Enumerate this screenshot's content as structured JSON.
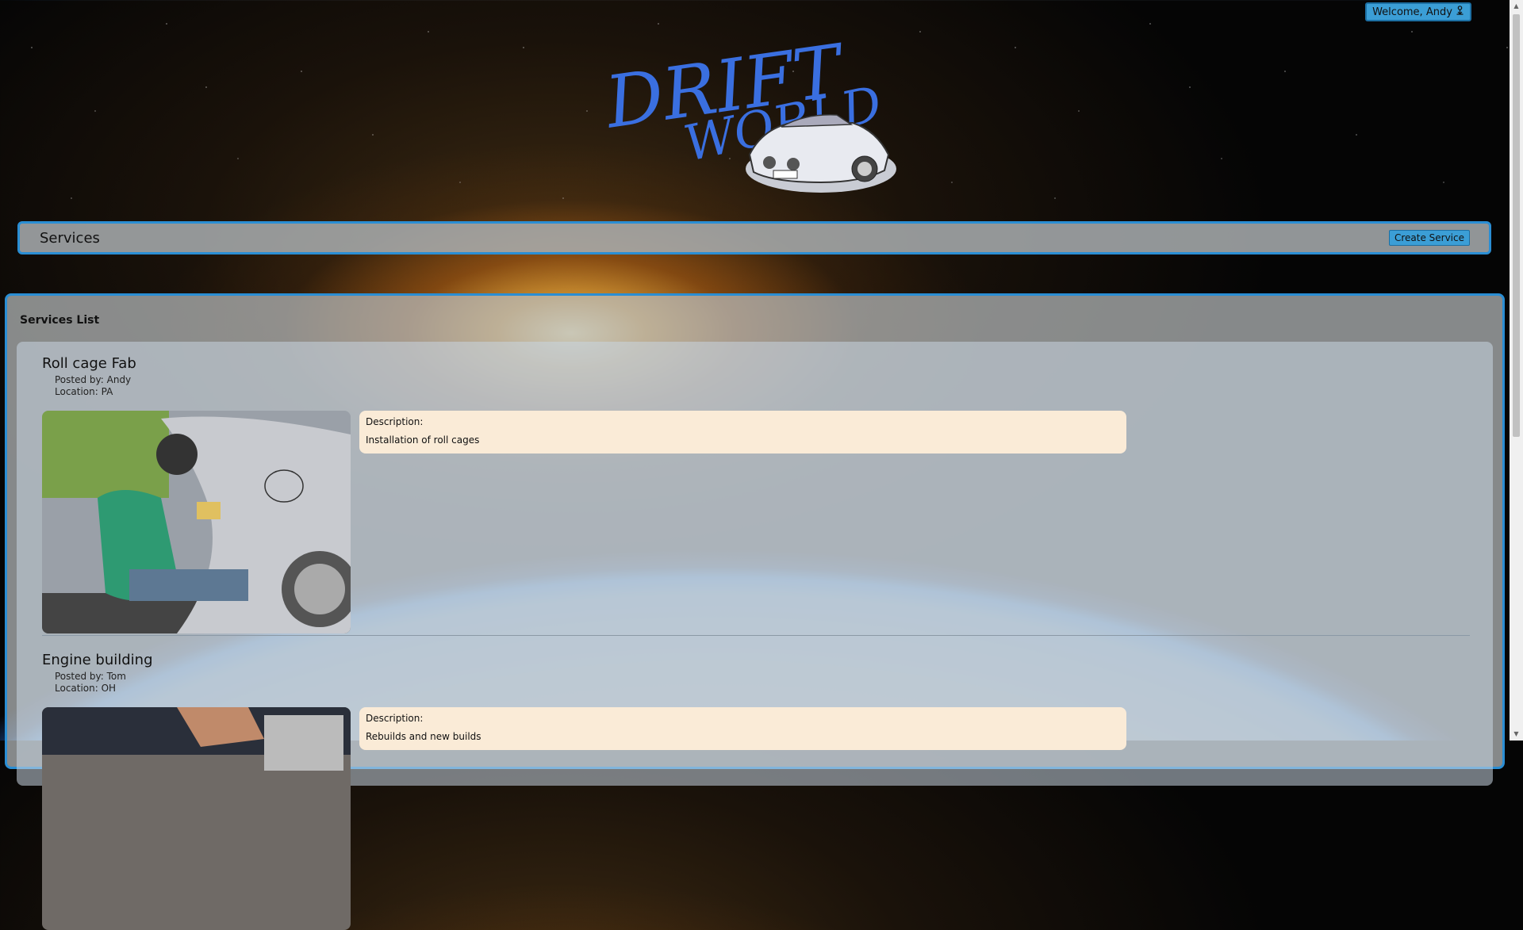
{
  "header": {
    "welcome_label": "Welcome, Andy",
    "welcome_icon": "user-icon",
    "logo_text_top": "DRIFT",
    "logo_text_bottom": "WORLD"
  },
  "services_bar": {
    "title": "Services",
    "create_label": "Create Service"
  },
  "list": {
    "heading": "Services List",
    "items": [
      {
        "title": "Roll cage Fab",
        "posted_by": "Posted by: Andy",
        "location": "Location: PA",
        "description_label": "Description:",
        "description": "Installation of roll cages"
      },
      {
        "title": "Engine building",
        "posted_by": "Posted by: Tom",
        "location": "Location: OH",
        "description_label": "Description:",
        "description": "Rebuilds and new builds"
      }
    ]
  },
  "colors": {
    "accent": "#3b9ed6",
    "border": "#2a8ed4",
    "description_bg": "#faebd7"
  }
}
